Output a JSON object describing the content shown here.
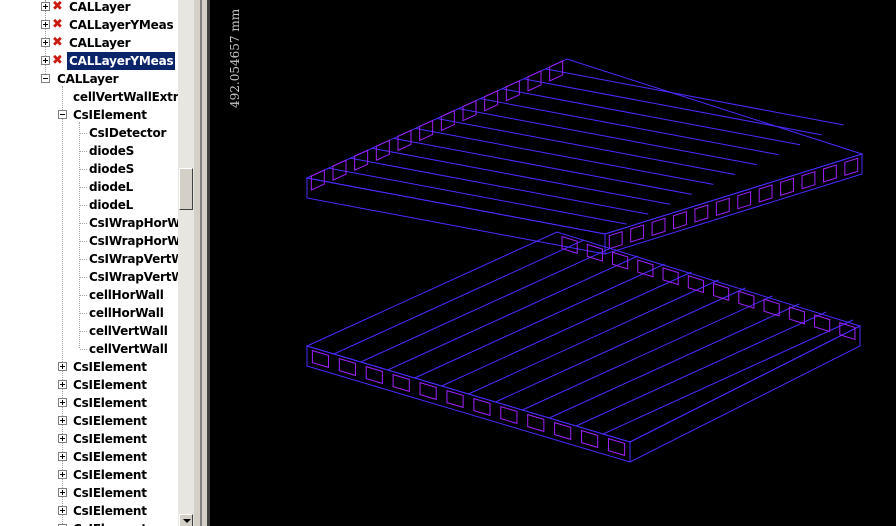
{
  "tree": {
    "items": [
      {
        "label": "CALLayer",
        "expander": "plus",
        "icon": "x",
        "sel": false
      },
      {
        "label": "CALLayerYMeas",
        "expander": "plus",
        "icon": "x",
        "sel": false
      },
      {
        "label": "CALLayer",
        "expander": "plus",
        "icon": "x",
        "sel": false
      },
      {
        "label": "CALLayerYMeas",
        "expander": "plus",
        "icon": "x",
        "sel": true
      },
      {
        "label": "CALLayer",
        "expander": "minus",
        "icon": "",
        "sel": false
      },
      {
        "label": "cellVertWallExtra",
        "expander": "",
        "icon": "",
        "sel": false
      },
      {
        "label": "CsIElement",
        "expander": "minus",
        "icon": "",
        "sel": false
      },
      {
        "label": "CsIDetector",
        "expander": "",
        "icon": "",
        "sel": false
      },
      {
        "label": "diodeS",
        "expander": "",
        "icon": "",
        "sel": false
      },
      {
        "label": "diodeS",
        "expander": "",
        "icon": "",
        "sel": false
      },
      {
        "label": "diodeL",
        "expander": "",
        "icon": "",
        "sel": false
      },
      {
        "label": "diodeL",
        "expander": "",
        "icon": "",
        "sel": false
      },
      {
        "label": "CsIWrapHorWall",
        "expander": "",
        "icon": "",
        "sel": false
      },
      {
        "label": "CsIWrapHorWall",
        "expander": "",
        "icon": "",
        "sel": false
      },
      {
        "label": "CsIWrapVertWall",
        "expander": "",
        "icon": "",
        "sel": false
      },
      {
        "label": "CsIWrapVertWall",
        "expander": "",
        "icon": "",
        "sel": false
      },
      {
        "label": "cellHorWall",
        "expander": "",
        "icon": "",
        "sel": false
      },
      {
        "label": "cellHorWall",
        "expander": "",
        "icon": "",
        "sel": false
      },
      {
        "label": "cellVertWall",
        "expander": "",
        "icon": "",
        "sel": false
      },
      {
        "label": "cellVertWall",
        "expander": "",
        "icon": "",
        "sel": false
      },
      {
        "label": "CsIElement",
        "expander": "plus",
        "icon": "",
        "sel": false
      },
      {
        "label": "CsIElement",
        "expander": "plus",
        "icon": "",
        "sel": false
      },
      {
        "label": "CsIElement",
        "expander": "plus",
        "icon": "",
        "sel": false
      },
      {
        "label": "CsIElement",
        "expander": "plus",
        "icon": "",
        "sel": false
      },
      {
        "label": "CsIElement",
        "expander": "plus",
        "icon": "",
        "sel": false
      },
      {
        "label": "CsIElement",
        "expander": "plus",
        "icon": "",
        "sel": false
      },
      {
        "label": "CsIElement",
        "expander": "plus",
        "icon": "",
        "sel": false
      },
      {
        "label": "CsIElement",
        "expander": "plus",
        "icon": "",
        "sel": false
      },
      {
        "label": "CsIElement",
        "expander": "plus",
        "icon": "",
        "sel": false
      },
      {
        "label": "CsIElement",
        "expander": "plus",
        "icon": "",
        "sel": false
      }
    ]
  },
  "viewer": {
    "scale_label": "492.054657 mm",
    "colors": {
      "background": "#000000",
      "outer": "#4a2cff",
      "inner": "#a020ff"
    },
    "upper_layer_logs": 12,
    "lower_layer_logs": 12
  },
  "scrollbar": {
    "position_fraction": 0.34
  }
}
